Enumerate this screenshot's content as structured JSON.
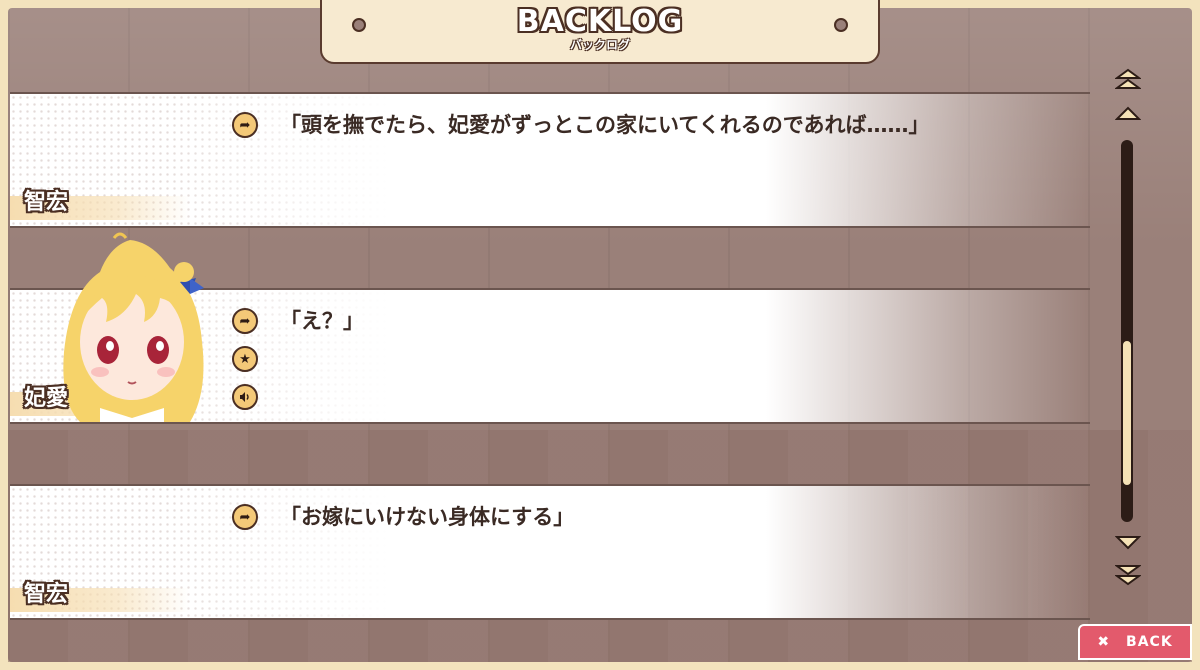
{
  "header": {
    "title": "BACKLOG",
    "subtitle": "バックログ"
  },
  "entries": [
    {
      "speaker": "智宏",
      "text": "「頭を撫でたら、妃愛がずっとこの家にいてくれるのであれば……」",
      "icons": [
        "arrow-right-icon"
      ]
    },
    {
      "speaker": "妃愛",
      "text": "「え？」",
      "icons": [
        "arrow-right-icon",
        "star-icon",
        "speaker-icon"
      ]
    },
    {
      "speaker": "智宏",
      "text": "「お嫁にいけない身体にする」",
      "icons": [
        "arrow-right-icon"
      ]
    }
  ],
  "scroll": {
    "position_fraction": 0.85
  },
  "back_button": {
    "label": "BACK",
    "icon": "close-icon"
  },
  "colors": {
    "frame": "#f3e3bd",
    "background": "#9a8079",
    "accent": "#f4c978",
    "back": "#e35a6c",
    "text": "#3a2a24"
  }
}
